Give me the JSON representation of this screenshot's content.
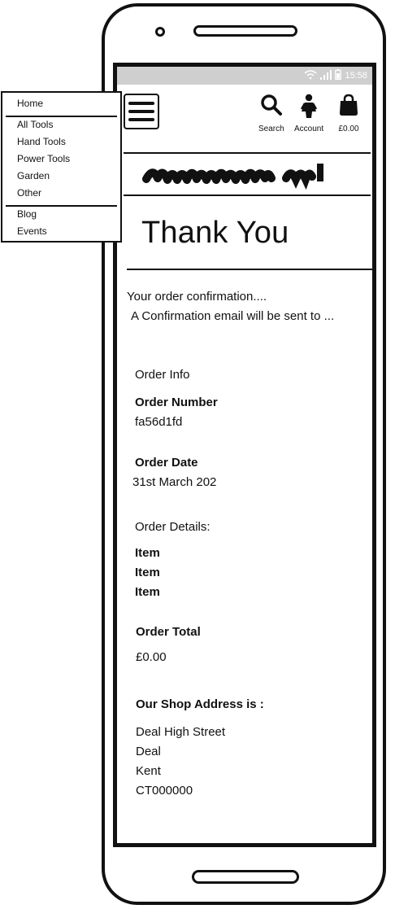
{
  "status_bar": {
    "icons": [
      "wifi-icon",
      "signal-icon",
      "battery-icon"
    ],
    "time": "15:58"
  },
  "header": {
    "menu_icon": "hamburger-icon",
    "search_label": "Search",
    "account_label": "Account",
    "cart_label": "£0.00"
  },
  "menu": {
    "home": "Home",
    "categories": [
      "All Tools",
      "Hand Tools",
      "Power Tools",
      "Garden",
      "Other"
    ],
    "extras": [
      "Blog",
      "Events"
    ]
  },
  "page": {
    "title": "Thank You",
    "confirmation_line": "Your order confirmation....",
    "email_line": "A Confirmation email will be sent to ...",
    "order_info_heading": "Order Info",
    "order_number_label": "Order Number",
    "order_number": "fa56d1fd",
    "order_date_label": "Order Date",
    "order_date": "31st March 202",
    "order_details_heading": "Order Details:",
    "items": [
      "Item",
      "Item",
      "Item"
    ],
    "order_total_label": "Order Total",
    "order_total": "£0.00",
    "shop_address_label": "Our Shop Address is :",
    "address_lines": [
      "Deal High Street",
      "Deal",
      "Kent",
      "CT000000"
    ]
  }
}
